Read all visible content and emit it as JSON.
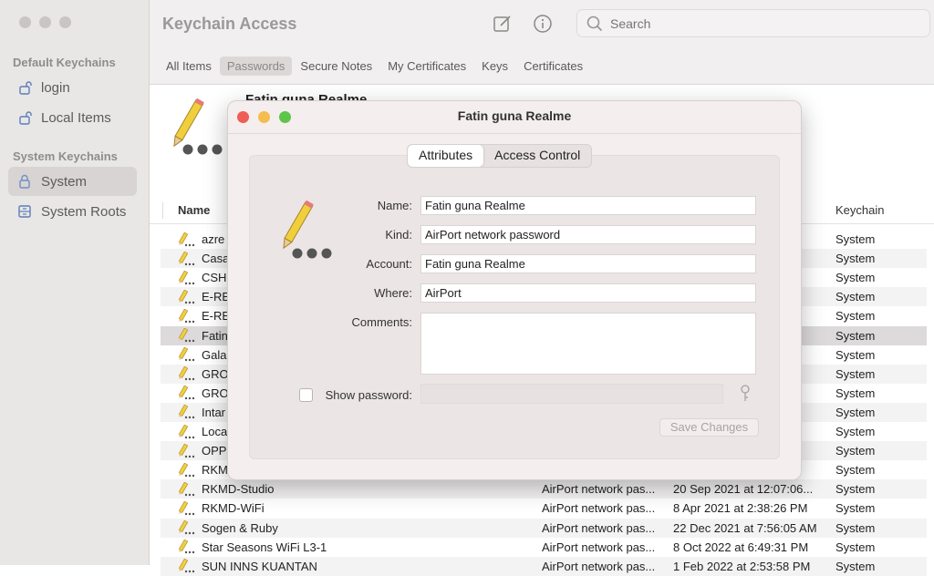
{
  "sidebar": {
    "default_header": "Default Keychains",
    "system_header": "System Keychains",
    "items": [
      {
        "label": "login",
        "icon": "lock-open-icon"
      },
      {
        "label": "Local Items",
        "icon": "lock-open-icon"
      },
      {
        "label": "System",
        "icon": "lock-icon"
      },
      {
        "label": "System Roots",
        "icon": "cabinet-icon"
      }
    ]
  },
  "toolbar": {
    "title": "Keychain Access",
    "search_placeholder": "Search",
    "tabs": [
      "All Items",
      "Passwords",
      "Secure Notes",
      "My Certificates",
      "Keys",
      "Certificates"
    ],
    "selected_tab": "Passwords"
  },
  "detail": {
    "name": "Fatin guna Realme"
  },
  "list": {
    "columns": {
      "name": "Name",
      "keychain": "Keychain"
    },
    "rows": [
      {
        "name": "azre",
        "kind": "",
        "date": "08...",
        "keychain": "System"
      },
      {
        "name": "Casa",
        "kind": "",
        "date": "20...",
        "keychain": "System"
      },
      {
        "name": "CSH",
        "kind": "",
        "date": "2 AM",
        "keychain": "System"
      },
      {
        "name": "E-RE",
        "kind": "",
        "date": "3 PM",
        "keychain": "System"
      },
      {
        "name": "E-RE",
        "kind": "",
        "date": "4 PM",
        "keychain": "System"
      },
      {
        "name": "Fatin",
        "kind": "",
        "date": "7 PM",
        "keychain": "System"
      },
      {
        "name": "Gala",
        "kind": "",
        "date": "3 AM",
        "keychain": "System"
      },
      {
        "name": "GRO",
        "kind": "",
        "date": "AM",
        "keychain": "System"
      },
      {
        "name": "GRO",
        "kind": "",
        "date": "2 AM",
        "keychain": "System"
      },
      {
        "name": "Intar",
        "kind": "",
        "date": "0 A...",
        "keychain": "System"
      },
      {
        "name": "Loca",
        "kind": "",
        "date": "PM",
        "keychain": "System"
      },
      {
        "name": "OPPO",
        "kind": "",
        "date": "5 PM",
        "keychain": "System"
      },
      {
        "name": "RKM",
        "kind": "",
        "date": "3...",
        "keychain": "System"
      },
      {
        "name": "RKMD-Studio",
        "kind": "AirPort network pas...",
        "date": "20 Sep 2021 at 12:07:06...",
        "keychain": "System"
      },
      {
        "name": "RKMD-WiFi",
        "kind": "AirPort network pas...",
        "date": "8 Apr 2021 at 2:38:26 PM",
        "keychain": "System"
      },
      {
        "name": "Sogen & Ruby",
        "kind": "AirPort network pas...",
        "date": "22 Dec 2021 at 7:56:05 AM",
        "keychain": "System"
      },
      {
        "name": "Star Seasons WiFi L3-1",
        "kind": "AirPort network pas...",
        "date": "8 Oct 2022 at 6:49:31 PM",
        "keychain": "System"
      },
      {
        "name": "SUN INNS KUANTAN",
        "kind": "AirPort network pas...",
        "date": "1 Feb 2022 at 2:53:58 PM",
        "keychain": "System"
      }
    ]
  },
  "dialog": {
    "title": "Fatin guna Realme",
    "tabs": [
      "Attributes",
      "Access Control"
    ],
    "selected_tab": "Attributes",
    "labels": {
      "name": "Name:",
      "kind": "Kind:",
      "account": "Account:",
      "where": "Where:",
      "comments": "Comments:",
      "show_password": "Show password:"
    },
    "values": {
      "name": "Fatin guna Realme",
      "kind": "AirPort network password",
      "account": "Fatin guna Realme",
      "where": "AirPort",
      "comments": ""
    },
    "show_password_checked": false,
    "save_button": "Save Changes"
  },
  "colors": {
    "close": "#ee5e57",
    "minimize": "#f4bd4f",
    "zoom": "#5ec54a"
  }
}
